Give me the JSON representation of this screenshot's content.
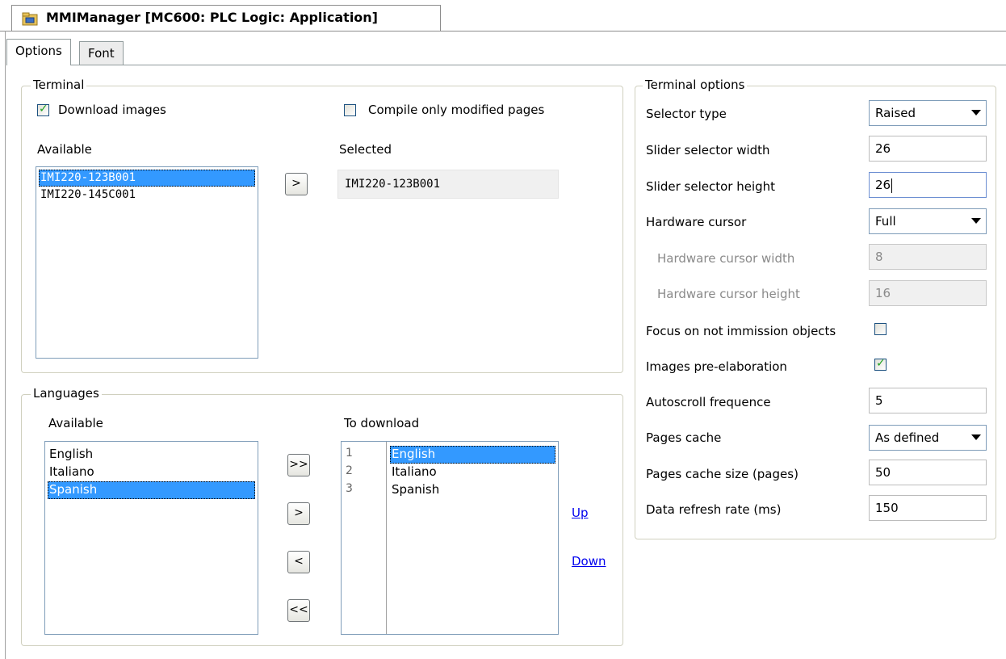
{
  "doc_tab": {
    "title": "MMIManager [MC600: PLC Logic: Application]",
    "icon": "folder-app-icon"
  },
  "tabs": [
    {
      "label": "Options"
    },
    {
      "label": "Font"
    }
  ],
  "terminal": {
    "legend": "Terminal",
    "download_images": {
      "label": "Download images",
      "checked": true
    },
    "compile_only_modified": {
      "label": "Compile only modified pages",
      "checked": false
    },
    "available_label": "Available",
    "available": [
      "IMI220-123B001",
      "IMI220-145C001"
    ],
    "available_selected_index": 0,
    "add_button": ">",
    "selected_label": "Selected",
    "selected_value": "IMI220-123B001"
  },
  "languages": {
    "legend": "Languages",
    "available_label": "Available",
    "available": [
      "English",
      "Italiano",
      "Spanish"
    ],
    "available_selected_index": 2,
    "buttons": {
      "add_all": ">>",
      "add": ">",
      "remove": "<",
      "remove_all": "<<"
    },
    "to_download_label": "To download",
    "to_download_numbers": [
      "1",
      "2",
      "3"
    ],
    "to_download": [
      "English",
      "Italiano",
      "Spanish"
    ],
    "to_download_selected_index": 0,
    "up_link": "Up",
    "down_link": "Down"
  },
  "terminal_options": {
    "legend": "Terminal options",
    "selector_type": {
      "label": "Selector type",
      "value": "Raised"
    },
    "slider_width": {
      "label": "Slider selector width",
      "value": "26"
    },
    "slider_height": {
      "label": "Slider selector height",
      "value": "26"
    },
    "hardware_cursor": {
      "label": "Hardware cursor",
      "value": "Full"
    },
    "hw_cursor_width": {
      "label": "Hardware cursor width",
      "value": "8"
    },
    "hw_cursor_height": {
      "label": "Hardware cursor height",
      "value": "16"
    },
    "focus_not_immission": {
      "label": "Focus on not immission objects",
      "checked": false
    },
    "images_preelaboration": {
      "label": "Images pre-elaboration",
      "checked": true
    },
    "autoscroll": {
      "label": "Autoscroll frequence",
      "value": "5"
    },
    "pages_cache": {
      "label": "Pages cache",
      "value": "As defined"
    },
    "pages_cache_size": {
      "label": "Pages cache size (pages)",
      "value": "50"
    },
    "refresh_rate": {
      "label": "Data refresh rate (ms)",
      "value": "150"
    }
  },
  "colors": {
    "selection": "#3399ff",
    "link": "#0000ee",
    "check": "#21a121"
  }
}
